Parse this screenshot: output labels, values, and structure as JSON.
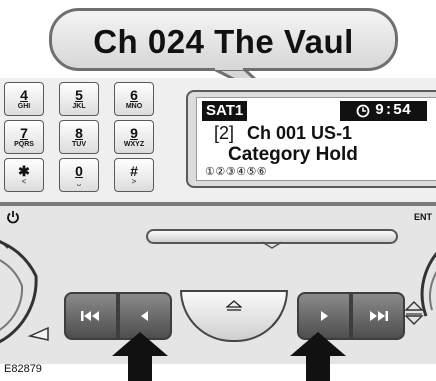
{
  "callout": {
    "text": "Ch 024  The Vaul"
  },
  "keypad": {
    "keys": [
      {
        "num": "4",
        "letters": "GHI"
      },
      {
        "num": "5",
        "letters": "JKL"
      },
      {
        "num": "6",
        "letters": "MNO"
      },
      {
        "num": "7",
        "letters": "PQRS"
      },
      {
        "num": "8",
        "letters": "TUV"
      },
      {
        "num": "9",
        "letters": "WXYZ"
      },
      {
        "num": "✱",
        "letters": "<"
      },
      {
        "num": "0",
        "letters": "⎵"
      },
      {
        "num": "#",
        "letters": ">"
      }
    ]
  },
  "display": {
    "band": "SAT1",
    "clock_icon": "clock-icon",
    "time": "9:54",
    "preset": "[2]",
    "channel": "Ch 001  US-1",
    "mode": "Category Hold",
    "preset_indicators": "①②③④⑤⑥"
  },
  "panel": {
    "power_icon": "power-icon",
    "enter_label": "ENT"
  },
  "controls": {
    "seek_back_icon": "skip-back-icon",
    "tune_down_icon": "step-left-icon",
    "eject_icon": "eject-icon",
    "tune_up_icon": "step-right-icon",
    "seek_forward_icon": "skip-forward-icon"
  },
  "caption": "E82879"
}
